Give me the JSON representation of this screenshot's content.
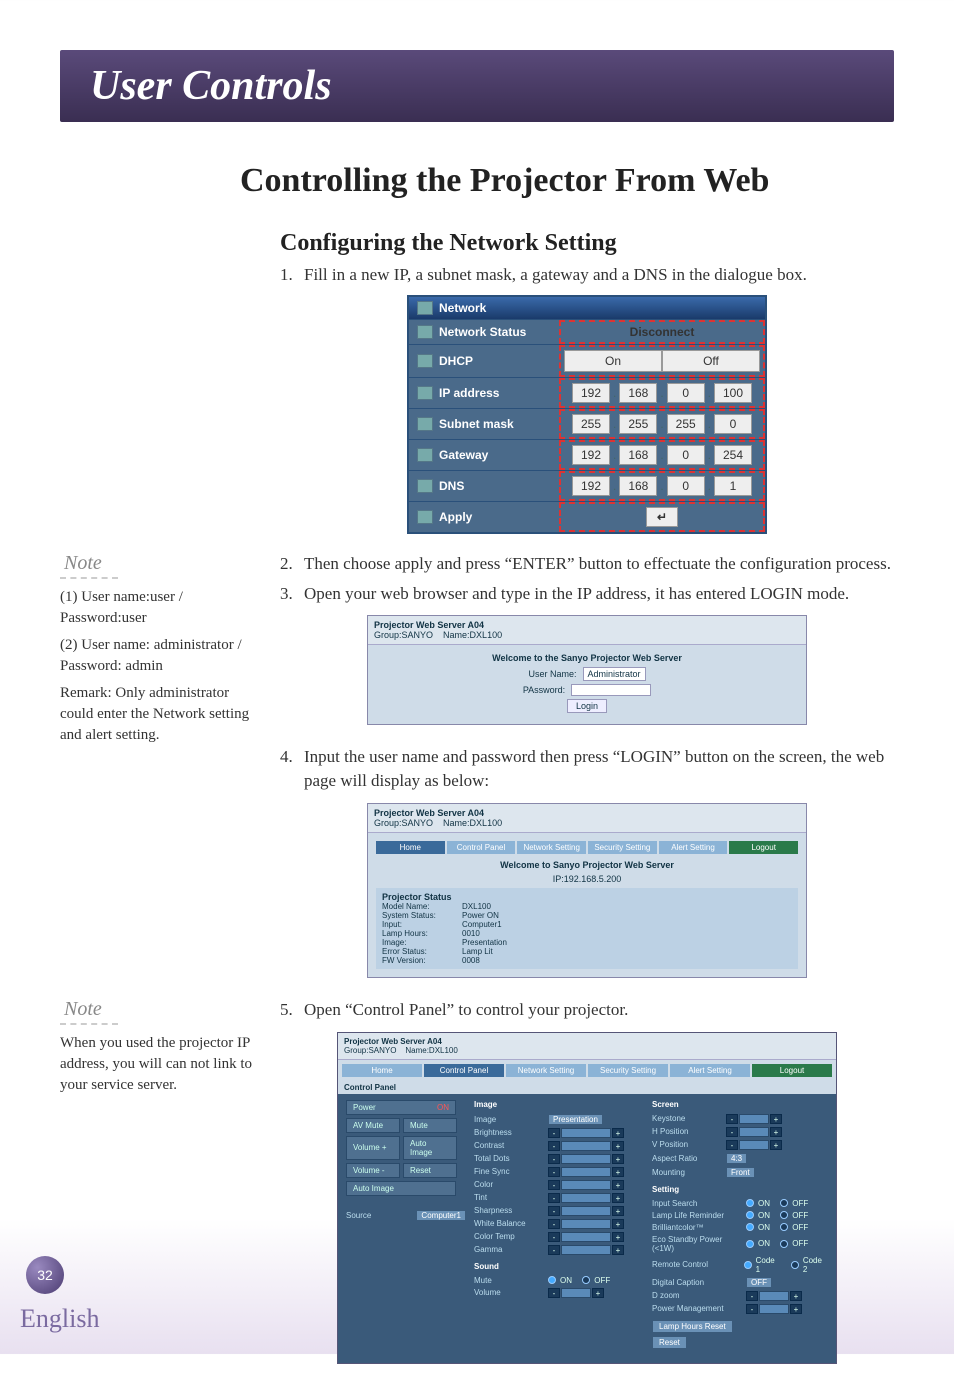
{
  "header": {
    "title": "User Controls"
  },
  "main_title": "Controlling the Projector From Web",
  "sub_title": "Configuring the Network Setting",
  "steps": {
    "s1": {
      "num": "1.",
      "text": "Fill in a new IP, a subnet mask, a gateway and a DNS in the dialogue box."
    },
    "s2": {
      "num": "2.",
      "text": "Then choose apply and press “ENTER” button to effectuate the configuration process."
    },
    "s3": {
      "num": "3.",
      "text": "Open your web browser and type in the IP address, it has entered LOGIN mode."
    },
    "s4": {
      "num": "4.",
      "text": "Input the user name and password then press “LOGIN” button on the screen, the web page will display as below:"
    },
    "s5": {
      "num": "5.",
      "text": "Open “Control Panel” to control your projector."
    }
  },
  "notes": {
    "label": "Note",
    "n1": {
      "a": "(1) User name:user / Password:user",
      "b": "(2) User name: administrator / Password: admin",
      "c": "Remark: Only administrator could enter the Network setting and alert setting."
    },
    "n2": "When you used the projector IP address, you will can not link to your service server."
  },
  "network": {
    "title": "Network",
    "rows": {
      "status": {
        "label": "Network Status",
        "value": "Disconnect"
      },
      "dhcp": {
        "label": "DHCP",
        "on": "On",
        "off": "Off"
      },
      "ip": {
        "label": "IP address",
        "a": "192",
        "b": "168",
        "c": "0",
        "d": "100"
      },
      "subnet": {
        "label": "Subnet mask",
        "a": "255",
        "b": "255",
        "c": "255",
        "d": "0"
      },
      "gw": {
        "label": "Gateway",
        "a": "192",
        "b": "168",
        "c": "0",
        "d": "254"
      },
      "dns": {
        "label": "DNS",
        "a": "192",
        "b": "168",
        "c": "0",
        "d": "1"
      },
      "apply": {
        "label": "Apply",
        "icon": "↵"
      }
    }
  },
  "login_shot": {
    "header1": "Projector Web Server A04",
    "header2a": "Group:SANYO",
    "header2b": "Name:DXL100",
    "welcome": "Welcome to the Sanyo Projector Web Server",
    "user_lbl": "User Name:",
    "user_val": "Administrator",
    "pass_lbl": "PAssword:",
    "login_btn": "Login"
  },
  "home_shot": {
    "header1": "Projector Web Server A04",
    "header2a": "Group:SANYO",
    "header2b": "Name:DXL100",
    "tabs": {
      "home": "Home",
      "cp": "Control Panel",
      "net": "Network Setting",
      "sec": "Security Setting",
      "alert": "Alert Setting",
      "logout": "Logout"
    },
    "welcome": "Welcome to Sanyo Projector Web Server",
    "ip": "IP:192.168.5.200",
    "status_title": "Projector Status",
    "status": {
      "model": {
        "k": "Model Name:",
        "v": "DXL100"
      },
      "sys": {
        "k": "System Status:",
        "v": "Power ON"
      },
      "input": {
        "k": "Input:",
        "v": "Computer1"
      },
      "lamp": {
        "k": "Lamp Hours:",
        "v": "0010"
      },
      "image": {
        "k": "Image:",
        "v": "Presentation"
      },
      "err": {
        "k": "Error Status:",
        "v": "Lamp Lit"
      },
      "fw": {
        "k": "FW Version:",
        "v": "0008"
      }
    }
  },
  "cp_shot": {
    "header1": "Projector Web Server A04",
    "header2a": "Group:SANYO",
    "header2b": "Name:DXL100",
    "tabs": {
      "home": "Home",
      "cp": "Control Panel",
      "net": "Network Setting",
      "sec": "Security Setting",
      "alert": "Alert Setting",
      "logout": "Logout"
    },
    "section_label": "Control Panel",
    "left": {
      "power": {
        "l": "Power",
        "r": "ON"
      },
      "shutter": {
        "l": "AV Mute",
        "r": "Mute"
      },
      "show": "Auto Image",
      "resync": "Auto Image",
      "volp": "Volume +",
      "reset": "Reset",
      "volm": "Volume -",
      "src_lbl": "Source",
      "src_val": "Computer1"
    },
    "image": {
      "title": "Image",
      "image_lbl": "Image",
      "image_val": "Presentation",
      "bright": "Brightness",
      "contrast": "Contrast",
      "noise": "Total Dots",
      "fine": "Fine Sync",
      "color": "Color",
      "tint": "Tint",
      "sharp": "Sharpness",
      "wb": "White Balance",
      "ctemp": "Color Temp",
      "gamma": "Gamma",
      "sound_title": "Sound",
      "mute": "Mute",
      "on": "ON",
      "off": "OFF",
      "vol": "Volume"
    },
    "screen": {
      "title": "Screen",
      "keystone": "Keystone",
      "hpos": "H Position",
      "vpos": "V Position",
      "aspect": "Aspect Ratio",
      "mount": "Mounting",
      "setting_title": "Setting",
      "inputsearch": "Input Search",
      "lamprem": "Lamp Life Reminder",
      "brilliant": "Brilliantcolor™",
      "eco": "Eco Standby Power (<1W)",
      "remote": "Remote Control",
      "dzoom": "Digital Caption",
      "szoom": "D zoom",
      "pm": "Power Management",
      "on": "ON",
      "off": "OFF",
      "code1": "Code 1",
      "code2": "Code 2",
      "off_val": "OFF",
      "front": "Front",
      "four_three": "4:3",
      "lamp_btn": "Lamp Hours Reset",
      "reset_btn": "Reset"
    }
  },
  "page_number": "32",
  "language": "English"
}
